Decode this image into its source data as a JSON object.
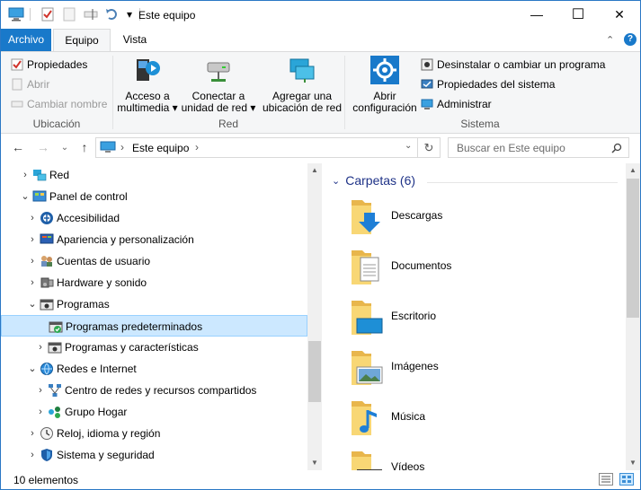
{
  "window": {
    "title": "Este equipo",
    "controls": {
      "minimize": "—",
      "maximize": "☐",
      "close": "✕"
    }
  },
  "quick_access": {
    "dropdown": "▾"
  },
  "ribbon": {
    "tabs": [
      "Archivo",
      "Equipo",
      "Vista"
    ],
    "active_tab": "Equipo",
    "groups": {
      "ubicacion": {
        "label": "Ubicación",
        "items": [
          "Propiedades",
          "Abrir",
          "Cambiar nombre"
        ]
      },
      "red": {
        "label": "Red",
        "buttons": [
          {
            "line1": "Acceso a",
            "line2": "multimedia ▾"
          },
          {
            "line1": "Conectar a",
            "line2": "unidad de red ▾"
          },
          {
            "line1": "Agregar una",
            "line2": "ubicación de red"
          }
        ]
      },
      "sistema": {
        "label": "Sistema",
        "big": {
          "line1": "Abrir",
          "line2": "configuración"
        },
        "items": [
          "Desinstalar o cambiar un programa",
          "Propiedades del sistema",
          "Administrar"
        ]
      }
    }
  },
  "address_bar": {
    "path": "Este equipo",
    "separator": "›",
    "search_placeholder": "Buscar en Este equipo"
  },
  "nav_tree": [
    {
      "label": "Red",
      "level": 0,
      "chevron": "›",
      "icon": "network-icon"
    },
    {
      "label": "Panel de control",
      "level": 0,
      "chevron": "⌄",
      "icon": "control-panel-icon"
    },
    {
      "label": "Accesibilidad",
      "level": 1,
      "chevron": "›",
      "icon": "accessibility-icon"
    },
    {
      "label": "Apariencia y personalización",
      "level": 1,
      "chevron": "›",
      "icon": "appearance-icon"
    },
    {
      "label": "Cuentas de usuario",
      "level": 1,
      "chevron": "›",
      "icon": "user-accounts-icon"
    },
    {
      "label": "Hardware y sonido",
      "level": 1,
      "chevron": "›",
      "icon": "hardware-sound-icon"
    },
    {
      "label": "Programas",
      "level": 1,
      "chevron": "⌄",
      "icon": "programs-icon"
    },
    {
      "label": "Programas predeterminados",
      "level": 2,
      "chevron": "",
      "icon": "default-programs-icon",
      "selected": true
    },
    {
      "label": "Programas y características",
      "level": 2,
      "chevron": "›",
      "icon": "programs-features-icon"
    },
    {
      "label": "Redes e Internet",
      "level": 1,
      "chevron": "⌄",
      "icon": "network-internet-icon"
    },
    {
      "label": "Centro de redes y recursos compartidos",
      "level": 2,
      "chevron": "›",
      "icon": "network-center-icon"
    },
    {
      "label": "Grupo Hogar",
      "level": 2,
      "chevron": "›",
      "icon": "homegroup-icon"
    },
    {
      "label": "Reloj, idioma y región",
      "level": 1,
      "chevron": "›",
      "icon": "clock-region-icon"
    },
    {
      "label": "Sistema y seguridad",
      "level": 1,
      "chevron": "›",
      "icon": "security-icon"
    }
  ],
  "content": {
    "group_title": "Carpetas (6)",
    "folders": [
      {
        "name": "Descargas",
        "icon": "downloads-folder-icon"
      },
      {
        "name": "Documentos",
        "icon": "documents-folder-icon"
      },
      {
        "name": "Escritorio",
        "icon": "desktop-folder-icon"
      },
      {
        "name": "Imágenes",
        "icon": "pictures-folder-icon"
      },
      {
        "name": "Música",
        "icon": "music-folder-icon"
      },
      {
        "name": "Vídeos",
        "icon": "videos-folder-icon"
      }
    ]
  },
  "status": {
    "count": "10 elementos"
  },
  "colors": {
    "accent": "#1979ca",
    "selection": "#cce8ff",
    "header": "#1e3287"
  }
}
